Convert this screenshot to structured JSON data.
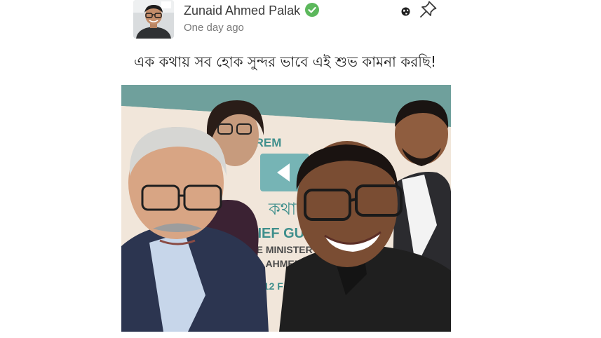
{
  "post": {
    "author_name": "Zunaid Ahmed Palak",
    "timestamp": "One day ago",
    "text": "এক কথায় সব হোক সুন্দর ভাবে এই শুভ কামনা করছি!",
    "verified_color": "#5cb85c",
    "icons": {
      "verified": "verified-check-icon",
      "visibility": "globe-icon",
      "pin": "pin-icon"
    }
  },
  "photo": {
    "banner_lines": [
      "L    NG CEREM",
      "কথা",
      "HIEF GU",
      "ATE MINISTER O",
      "AID AHMED PA",
      ", 12 F"
    ],
    "banner_color": "#3f8f8c"
  }
}
